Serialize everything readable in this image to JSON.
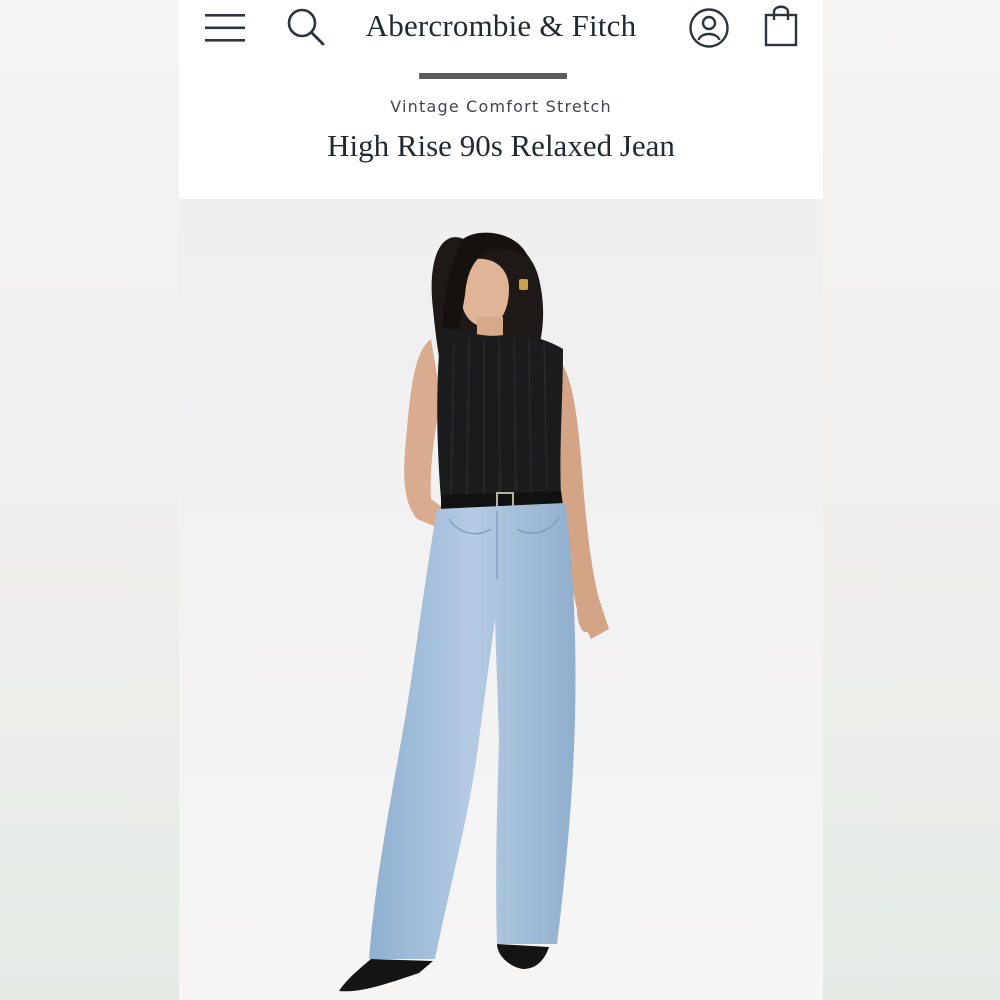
{
  "header": {
    "brand": "Abercrombie & Fitch",
    "menu_icon": "hamburger-menu-icon",
    "search_icon": "search-icon",
    "account_icon": "account-icon",
    "bag_icon": "shopping-bag-icon"
  },
  "product": {
    "collection": "Vintage Comfort Stretch",
    "title": "High Rise 90s Relaxed Jean"
  },
  "colors": {
    "brand_text": "#1f2a36",
    "handle": "#5b5b5b",
    "denim": "#9fbad6",
    "top": "#1b1c1e"
  }
}
